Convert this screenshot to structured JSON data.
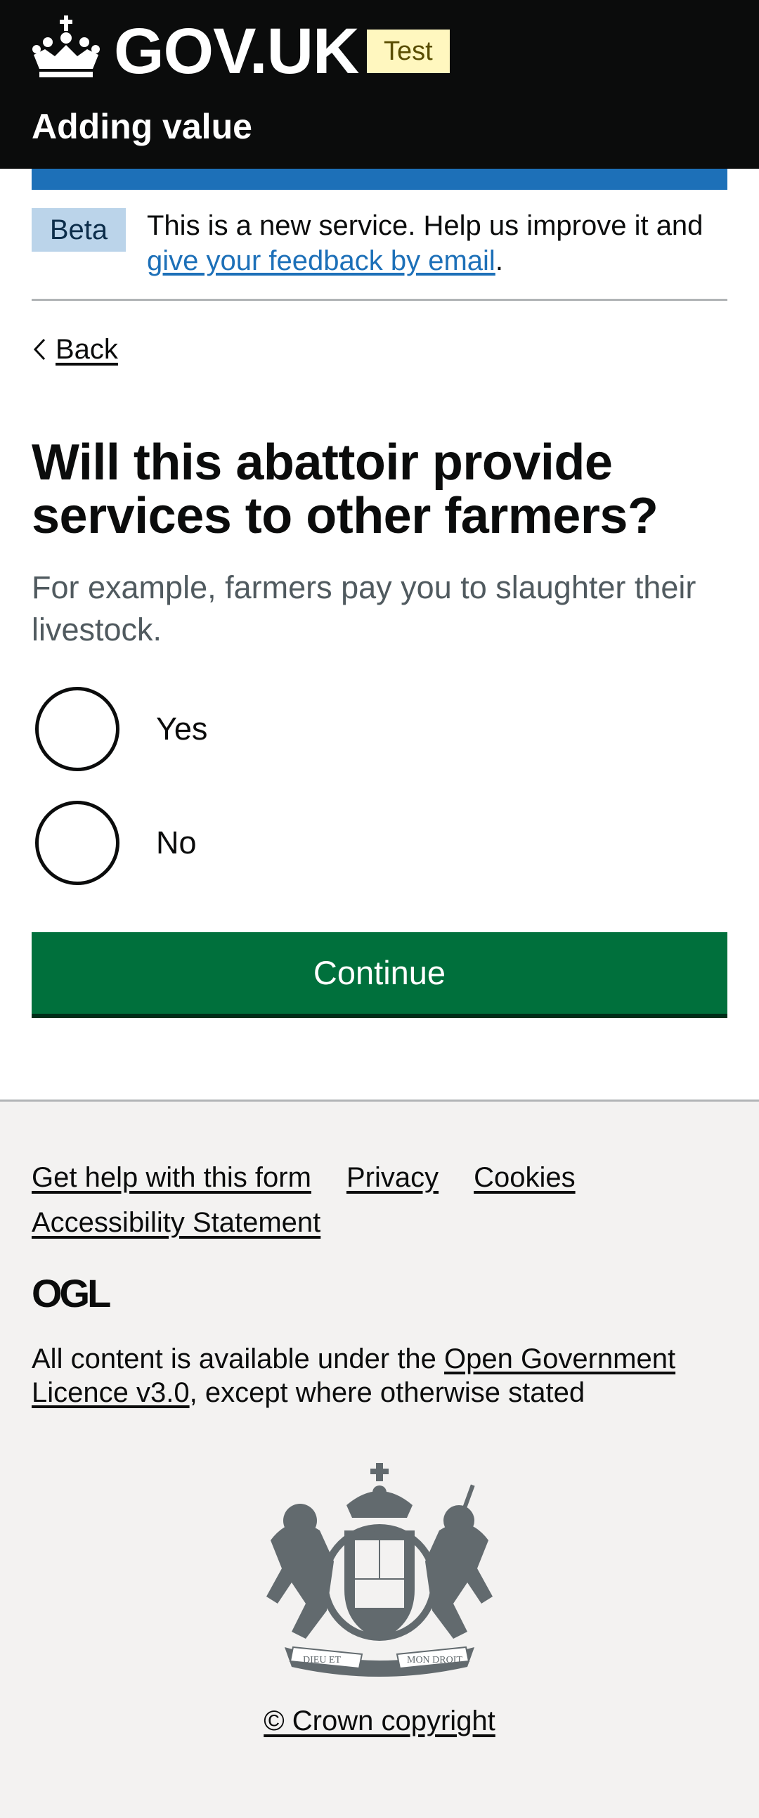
{
  "header": {
    "logo_text": "GOV.UK",
    "environment_tag": "Test",
    "service_name": "Adding value",
    "colors": {
      "background": "#0b0c0c",
      "accent_bar": "#1d70b8",
      "tag_bg": "#fff7bf"
    }
  },
  "phase_banner": {
    "tag": "Beta",
    "text_before": "This is a new service. Help us improve it and ",
    "link_text": "give your feedback by email",
    "text_after": "."
  },
  "back_link": {
    "label": "Back",
    "icon": "chevron-left-icon"
  },
  "question": {
    "heading": "Will this abattoir provide services to other farmers?",
    "hint": "For example, farmers pay you to slaughter their livestock.",
    "options": [
      {
        "label": "Yes",
        "selected": false
      },
      {
        "label": "No",
        "selected": false
      }
    ]
  },
  "continue_button": {
    "label": "Continue",
    "color": "#00703c"
  },
  "footer": {
    "links": [
      "Get help with this form",
      "Privacy",
      "Cookies",
      "Accessibility Statement"
    ],
    "ogl_logo_text": "OGL",
    "licence_before": "All content is available under the ",
    "licence_link": "Open Government Licence v3.0",
    "licence_after": ", except where otherwise stated",
    "crest_motto_left": "DIEU ET",
    "crest_motto_right": "MON DROIT",
    "copyright": "© Crown copyright",
    "background": "#f3f2f1"
  }
}
